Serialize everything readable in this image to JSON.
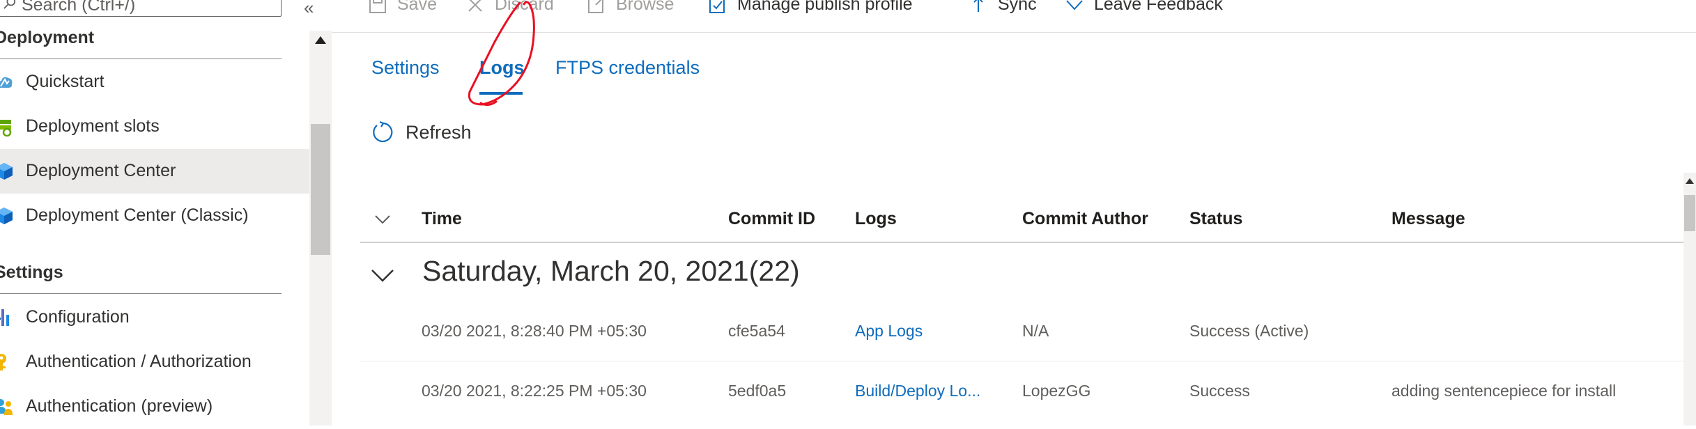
{
  "sidebar": {
    "search_placeholder": "Search (Ctrl+/)",
    "collapse_glyph": "«",
    "sections": [
      {
        "title": "Deployment",
        "items": [
          {
            "label": "Quickstart",
            "icon": "quickstart-icon"
          },
          {
            "label": "Deployment slots",
            "icon": "deployment-slots-icon"
          },
          {
            "label": "Deployment Center",
            "icon": "deployment-center-icon",
            "selected": true
          },
          {
            "label": "Deployment Center (Classic)",
            "icon": "deployment-center-classic-icon"
          }
        ]
      },
      {
        "title": "Settings",
        "items": [
          {
            "label": "Configuration",
            "icon": "configuration-icon"
          },
          {
            "label": "Authentication / Authorization",
            "icon": "key-icon"
          },
          {
            "label": "Authentication (preview)",
            "icon": "people-icon"
          }
        ]
      }
    ]
  },
  "toolbar": {
    "save": "Save",
    "discard": "Discard",
    "browse": "Browse",
    "manage_publish_profile": "Manage publish profile",
    "sync": "Sync",
    "leave_feedback": "Leave Feedback"
  },
  "tabs": [
    {
      "label": "Settings"
    },
    {
      "label": "Logs",
      "active": true
    },
    {
      "label": "FTPS credentials"
    }
  ],
  "refresh_label": "Refresh",
  "table": {
    "columns": [
      "Time",
      "Commit ID",
      "Logs",
      "Commit Author",
      "Status",
      "Message"
    ],
    "group": {
      "label": "Saturday, March 20, 2021",
      "count": "(22)"
    },
    "rows": [
      {
        "time": "03/20 2021, 8:28:40 PM +05:30",
        "commit_id": "cfe5a54",
        "logs": "App Logs",
        "author": "N/A",
        "status": "Success (Active)",
        "message": ""
      },
      {
        "time": "03/20 2021, 8:22:25 PM +05:30",
        "commit_id": "5edf0a5",
        "logs": "Build/Deploy Lo...",
        "author": "LopezGG",
        "status": "Success",
        "message": "adding sentencepiece for install"
      }
    ]
  },
  "colors": {
    "link": "#0f6cbd",
    "selected_nav_bg": "#edebe9",
    "annotation": "#e81123"
  }
}
